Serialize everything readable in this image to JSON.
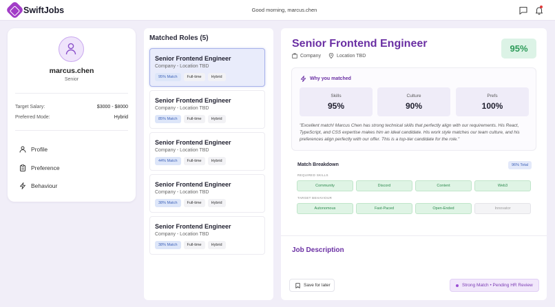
{
  "app": {
    "name": "SwiftJobs",
    "greeting": "Good morning, marcus.chen"
  },
  "profile": {
    "name": "marcus.chen",
    "level": "Senior",
    "salary_label": "Target Salary:",
    "salary_value": "$3000 - $8000",
    "mode_label": "Preferred Mode:",
    "mode_value": "Hybrid",
    "nav": [
      {
        "label": "Profile",
        "icon": "user-icon"
      },
      {
        "label": "Preference",
        "icon": "clipboard-icon"
      },
      {
        "label": "Behaviour",
        "icon": "lightning-icon"
      }
    ]
  },
  "roles": {
    "title": "Matched Roles (5)",
    "items": [
      {
        "title": "Senior Frontend Engineer",
        "sub": "Company - Location TBD",
        "match": "95% Match",
        "type": "Full-time",
        "mode": "Hybrid"
      },
      {
        "title": "Senior Frontend Engineer",
        "sub": "Company - Location TBD",
        "match": "85% Match",
        "type": "Full-time",
        "mode": "Hybrid"
      },
      {
        "title": "Senior Frontend Engineer",
        "sub": "Company - Location TBD",
        "match": "44% Match",
        "type": "Full-time",
        "mode": "Hybrid"
      },
      {
        "title": "Senior Frontend Engineer",
        "sub": "Company - Location TBD",
        "match": "38% Match",
        "type": "Full-time",
        "mode": "Hybrid"
      },
      {
        "title": "Senior Frontend Engineer",
        "sub": "Company - Location TBD",
        "match": "38% Match",
        "type": "Full-time",
        "mode": "Hybrid"
      }
    ]
  },
  "detail": {
    "title": "Senior Frontend Engineer",
    "company": "Company",
    "location": "Location TBD",
    "score": "95%",
    "why_title": "Why you matched",
    "stats": [
      {
        "label": "Skills",
        "value": "95%"
      },
      {
        "label": "Culture",
        "value": "90%"
      },
      {
        "label": "Prefs",
        "value": "100%"
      }
    ],
    "quote": "\"Excellent match! Marcus Chen has strong technical skills that perfectly align with our requirements. His React, TypeScript, and CSS expertise makes him an ideal candidate. His work style matches our team culture, and his preferences align perfectly with our offer. This is a top-tier candidate for the role.\"",
    "breakdown": {
      "title": "Match Breakdown",
      "total": "96% Total",
      "skills_label": "REQUIRED SKILLS",
      "skills": [
        "Community",
        "Discord",
        "Content",
        "Web3"
      ],
      "behaviour_label": "TARGET BEHAVIOUR",
      "behaviours": [
        {
          "label": "Autonomous",
          "state": "green"
        },
        {
          "label": "Fast-Paced",
          "state": "green"
        },
        {
          "label": "Open-Ended",
          "state": "green"
        },
        {
          "label": "Innovator",
          "state": "gray"
        }
      ]
    },
    "jd_title": "Job Description",
    "save_label": "Save for later",
    "status": "Strong Match • Pending HR Review"
  },
  "colors": {
    "brand": "#a23dc7",
    "accent": "#6a2fa3",
    "match_green": "#2c9a58"
  }
}
